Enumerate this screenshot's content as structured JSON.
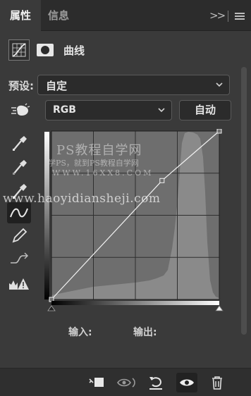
{
  "tabs": {
    "properties": "属性",
    "info": "信息"
  },
  "header": {
    "title": "曲线"
  },
  "preset": {
    "label": "预设:",
    "value": "自定"
  },
  "channel": {
    "value": "RGB",
    "auto_label": "自动"
  },
  "tools": [
    "target-adjustment",
    "black-point-eyedropper",
    "gray-point-eyedropper",
    "white-point-eyedropper",
    "edit-points-curve",
    "draw-freehand",
    "smooth-curve",
    "clipping-warning"
  ],
  "watermark": {
    "line1": "PS教程自学网",
    "line2": "学PS，就到PS教程自学网",
    "line3": "WWW.16XX8.COM",
    "line4": "www.haoyidiansheji.com"
  },
  "io": {
    "input_label": "输入:",
    "output_label": "输出:"
  },
  "curve": {
    "points": [
      [
        0,
        0
      ],
      [
        168,
        180
      ],
      [
        255,
        255
      ]
    ]
  },
  "colors": {
    "panel_bg": "#3a3a3a",
    "tab_bg": "#2c2c2c",
    "text": "#dcdcdc"
  }
}
